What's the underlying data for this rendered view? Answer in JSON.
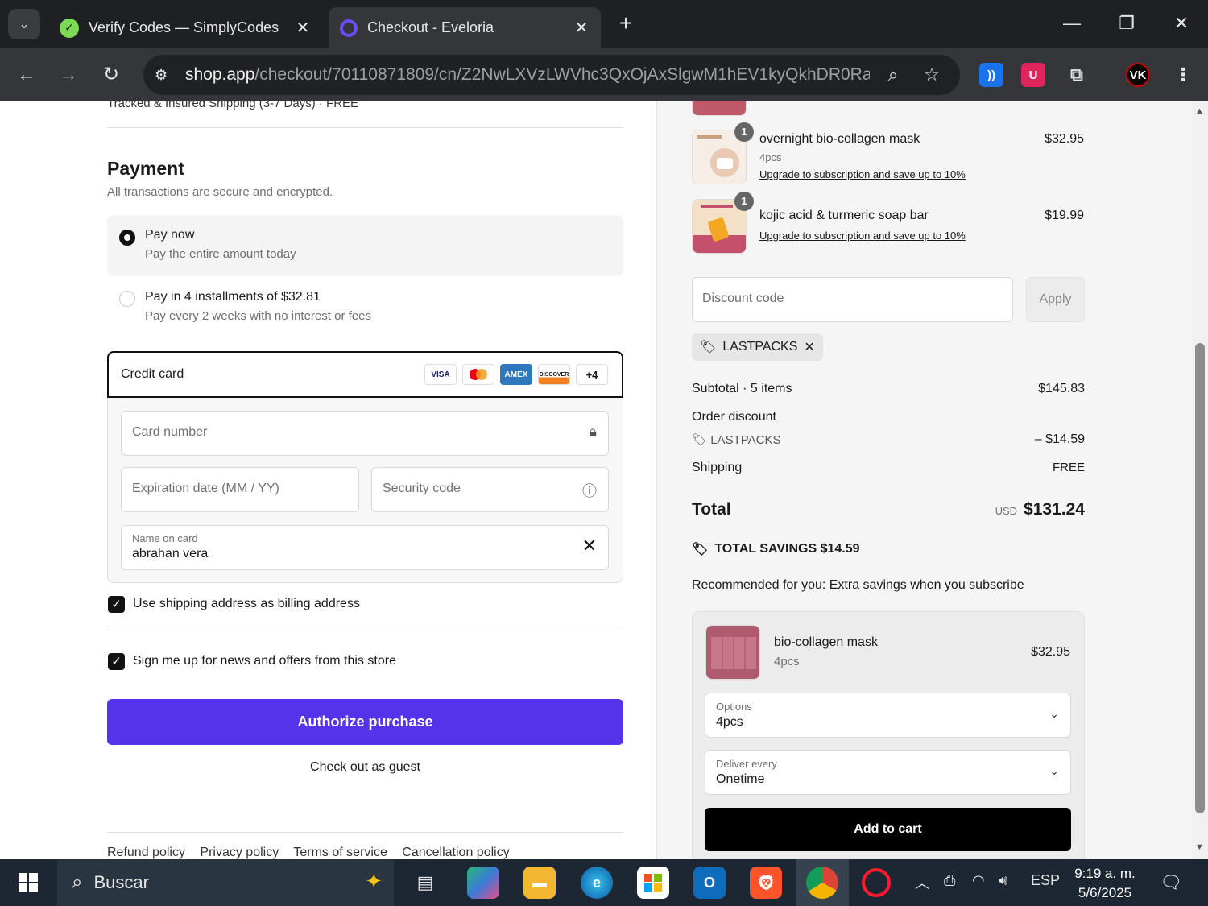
{
  "browser": {
    "tabs": [
      {
        "title": "Verify Codes — SimplyCodes"
      },
      {
        "title": "Checkout - Eveloria"
      }
    ],
    "url_host": "shop.app",
    "url_path": "/checkout/70110871809/cn/Z2NwLXVzLWVhc3QxOjAxSlgwM1hEV1kyQkhDR0RaV..."
  },
  "left": {
    "shipping_line": "Tracked & Insured Shipping (3-7 Days) · FREE",
    "payment_title": "Payment",
    "payment_subtitle": "All transactions are secure and encrypted.",
    "pay_now": {
      "title": "Pay now",
      "subtitle": "Pay the entire amount today"
    },
    "pay_installments": {
      "title": "Pay in 4 installments of $32.81",
      "subtitle": "Pay every 2 weeks with no interest or fees"
    },
    "credit_card_label": "Credit card",
    "card_logos": [
      "VISA",
      "MC",
      "AMEX",
      "DISCOVER"
    ],
    "more_cards": "+4",
    "card_number_ph": "Card number",
    "expiry_ph": "Expiration date (MM / YY)",
    "security_ph": "Security code",
    "name_label": "Name on card",
    "name_value": "abrahan vera",
    "billing_checkbox": "Use shipping address as billing address",
    "news_checkbox": "Sign me up for news and offers from this store",
    "authorize_button": "Authorize purchase",
    "guest_link": "Check out as guest",
    "footer_links": [
      "Refund policy",
      "Privacy policy",
      "Terms of service",
      "Cancellation policy"
    ]
  },
  "right": {
    "items": [
      {
        "qty": "1",
        "name": "overnight bio-collagen mask",
        "variant": "4pcs",
        "upgrade": "Upgrade to subscription and save up to 10%",
        "price": "$32.95"
      },
      {
        "qty": "1",
        "name": "kojic acid & turmeric soap bar",
        "upgrade": "Upgrade to subscription and save up to 10%",
        "price": "$19.99"
      }
    ],
    "discount_ph": "Discount code",
    "apply_button": "Apply",
    "applied_code": "LASTPACKS",
    "subtotal_label": "Subtotal · 5 items",
    "subtotal_value": "$145.83",
    "order_discount_label": "Order discount",
    "discount_code_line": "LASTPACKS",
    "discount_value": "– $14.59",
    "shipping_label": "Shipping",
    "shipping_value": "FREE",
    "total_label": "Total",
    "currency": "USD",
    "total_value": "$131.24",
    "savings": "TOTAL SAVINGS  $14.59",
    "recommend_text": "Recommended for you: Extra savings when you subscribe",
    "rec_item": {
      "name": "bio-collagen mask",
      "variant": "4pcs",
      "price": "$32.95"
    },
    "options_label": "Options",
    "options_value": "4pcs",
    "deliver_label": "Deliver every",
    "deliver_value": "Onetime",
    "add_to_cart": "Add to cart"
  },
  "taskbar": {
    "search_text": "Buscar",
    "language": "ESP",
    "time": "9:19 a. m.",
    "date": "5/6/2025"
  },
  "colors": {
    "accent": "#5433eb",
    "tab_bg": "#1f2023",
    "taskbar_bg": "#1c2733"
  }
}
